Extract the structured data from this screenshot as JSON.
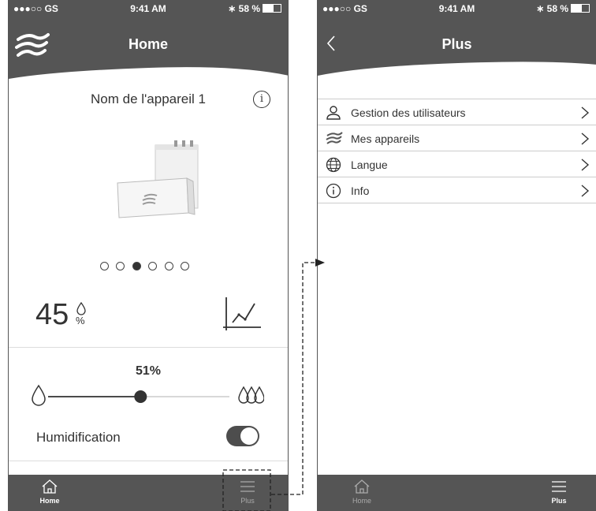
{
  "status_bar": {
    "carrier": "●●●○○ GS",
    "time": "9:41 AM",
    "battery": "58 %"
  },
  "left": {
    "title": "Home",
    "device_name": "Nom de l'appareil 1",
    "carousel": {
      "count": 6,
      "active_index": 2
    },
    "current_humidity": "45",
    "target_humidity": "51%",
    "target_level": 0.51,
    "humidification_label": "Humidification",
    "humidification_on": true,
    "tabs": [
      {
        "label": "Home",
        "active": true
      },
      {
        "label": "Plus",
        "active": false
      }
    ]
  },
  "right": {
    "title": "Plus",
    "menu": [
      {
        "label": "Gestion des utilisateurs",
        "icon": "user-icon"
      },
      {
        "label": "Mes appareils",
        "icon": "device-logo-icon"
      },
      {
        "label": "Langue",
        "icon": "globe-icon"
      },
      {
        "label": "Info",
        "icon": "info-icon"
      }
    ],
    "tabs": [
      {
        "label": "Home",
        "active": false
      },
      {
        "label": "Plus",
        "active": true
      }
    ]
  },
  "colors": {
    "header": "#555555",
    "tabbar": "#555555",
    "accent": "#333333"
  }
}
